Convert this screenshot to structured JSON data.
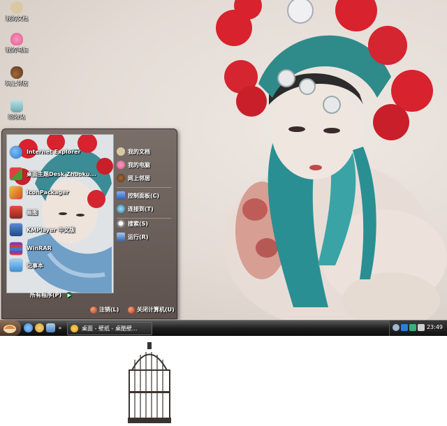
{
  "desktop_icons": [
    {
      "label": "我的文档",
      "icon": "folder-icon",
      "color": "#d9c9a3"
    },
    {
      "label": "我的电脑",
      "icon": "lotus-icon",
      "color": "#e35a8a"
    },
    {
      "label": "网上邻居",
      "icon": "gourd-icon",
      "color": "#7a4a2a"
    },
    {
      "label": "回收站",
      "icon": "recycle-bin-icon",
      "color": "#8fc3c7"
    }
  ],
  "start_menu": {
    "pinned": [
      {
        "label": "Internet Explorer",
        "icon": "internet-explorer-icon",
        "color": "#2b79d6"
      },
      {
        "label": "桌面主题Desk Zhuoku...",
        "icon": "theme-icon",
        "color": "#4a9a3a"
      },
      {
        "label": "IconPackager",
        "icon": "iconpackager-icon",
        "color": "#d64a2a"
      },
      {
        "label": "画图",
        "icon": "paint-icon",
        "color": "#c0392b"
      },
      {
        "label": "KMPlayer 中文版",
        "icon": "kmplayer-icon",
        "color": "#2a5fa8"
      },
      {
        "label": "WinRAR",
        "icon": "winrar-icon",
        "color": "#8b3aa8"
      },
      {
        "label": "记事本",
        "icon": "notepad-icon",
        "color": "#3a8fd6"
      }
    ],
    "all_programs": "所有程序(P)",
    "right_items": [
      {
        "label": "我的文档",
        "icon": "folder-icon",
        "color": "#d9c9a3"
      },
      {
        "label": "我的电脑",
        "icon": "lotus-icon",
        "color": "#e35a8a"
      },
      {
        "label": "网上邻居",
        "icon": "gourd-icon",
        "color": "#7a4a2a"
      },
      {
        "label": "控制面板(C)",
        "icon": "control-panel-icon",
        "color": "#4a7ad6"
      },
      {
        "label": "连接到(T)",
        "icon": "connect-icon",
        "color": "#3aa0d6"
      },
      {
        "label": "搜索(S)",
        "icon": "search-icon",
        "color": "#e0e0e0"
      },
      {
        "label": "运行(R)",
        "icon": "run-icon",
        "color": "#5a8ad6"
      }
    ],
    "logoff": "注销(L)",
    "shutdown": "关闭计算机(U)"
  },
  "taskbar": {
    "quick_launch": [
      {
        "icon": "ie-quicklaunch-icon",
        "color": "#3b8be0"
      },
      {
        "icon": "media-player-icon",
        "color": "#d9a02a"
      },
      {
        "icon": "show-desktop-icon",
        "color": "#7ab0e0"
      }
    ],
    "tasks": [
      {
        "label": "桌面 - 壁纸 - 桌酷壁...",
        "icon": "browser-icon",
        "color": "#e0a020"
      }
    ],
    "tray_icons": [
      {
        "icon": "arrow-left-icon",
        "color": "#9fb6d6"
      },
      {
        "icon": "shield-icon",
        "color": "#2a7fd6"
      },
      {
        "icon": "network-icon",
        "color": "#3ab07a"
      },
      {
        "icon": "volume-icon",
        "color": "#d0d0d0"
      }
    ],
    "clock": "23:49"
  }
}
